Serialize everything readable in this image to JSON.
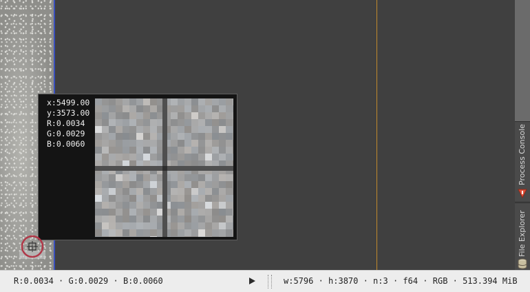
{
  "readout": {
    "x": "x:5499.00",
    "y": "y:3573.00",
    "r": "R:0.0034",
    "g": "G:0.0029",
    "b": "B:0.0060"
  },
  "sidebar": {
    "process_console": "Process Console",
    "file_explorer": "File Explorer"
  },
  "status": {
    "pixel_values": "R:0.0034 · G:0.0029 · B:0.0060",
    "image_info": "w:5796 · h:3870 · n:3 · f64 · RGB · 513.394 MiB"
  },
  "icons": {
    "play": "play-icon",
    "process_console": "warning-triangle-icon",
    "file_explorer": "cylinder-icon",
    "target": "crosshair-target-icon"
  },
  "colors": {
    "workspace": "#404040",
    "guide": "#c28a2c",
    "image_border": "#3a4fbd",
    "process_console_icon": "#e0503a"
  }
}
